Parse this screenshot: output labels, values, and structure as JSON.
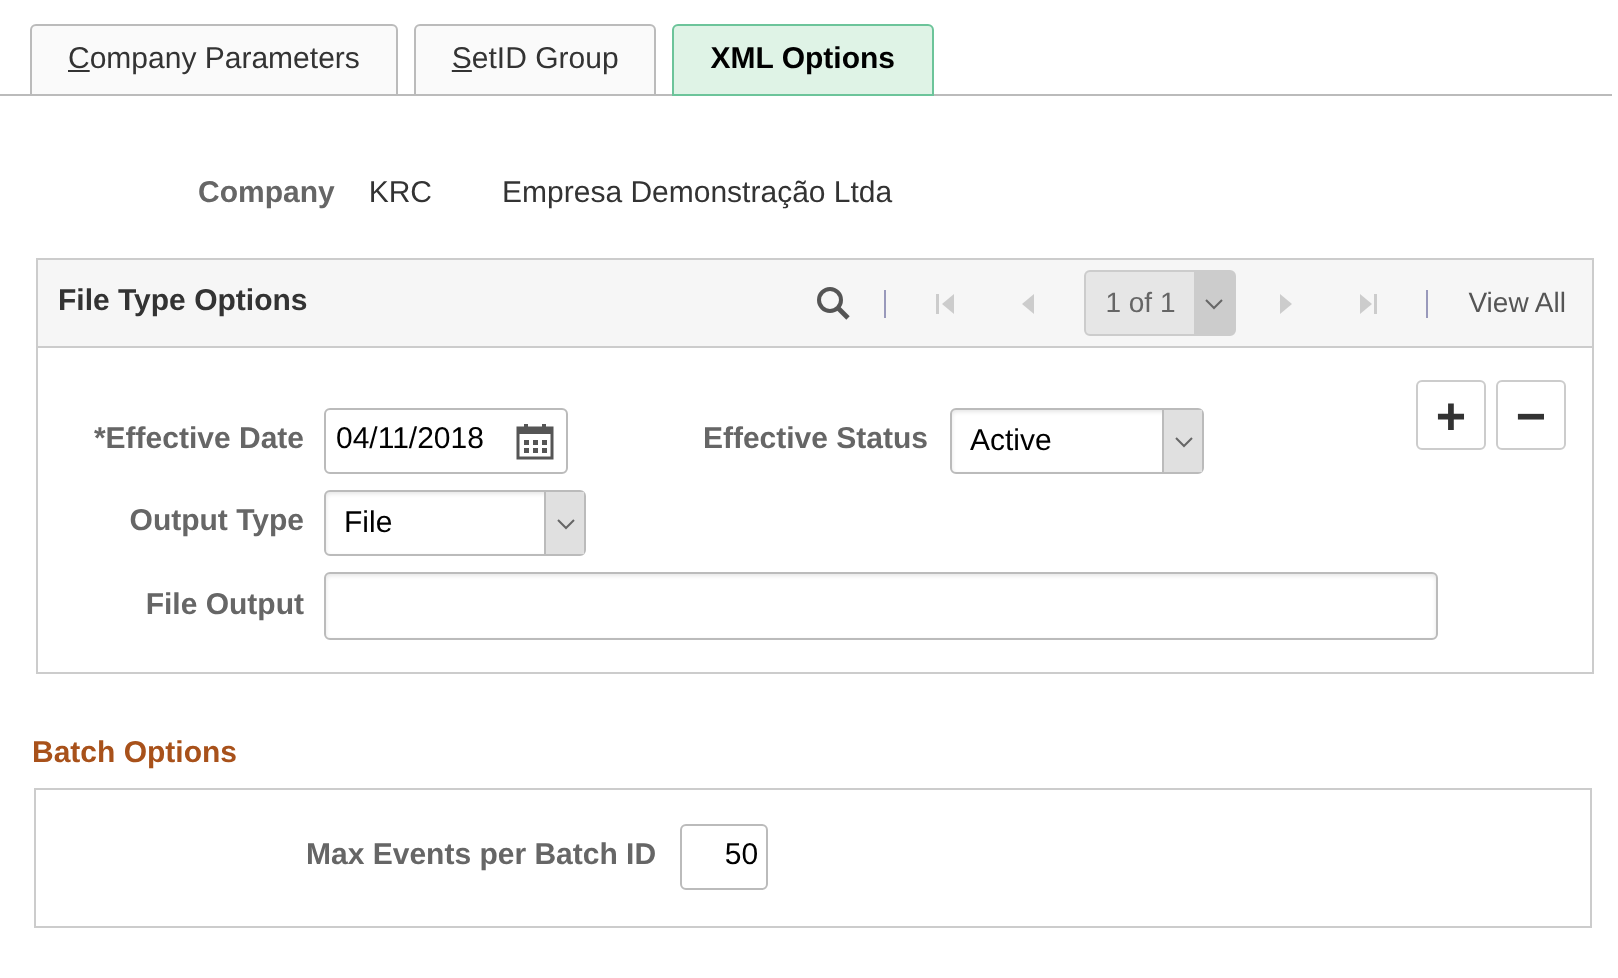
{
  "tabs": [
    {
      "label": "Company Parameters",
      "first_letter_underlined": true,
      "selected": false
    },
    {
      "label": "SetID Group",
      "first_letter_underlined": true,
      "selected": false
    },
    {
      "label": "XML Options",
      "first_letter_underlined": false,
      "selected": true
    }
  ],
  "company": {
    "label": "Company",
    "code": "KRC",
    "name": "Empresa Demonstração Ltda"
  },
  "file_type_options": {
    "title": "File Type Options",
    "pager": "1 of 1",
    "view_all": "View All",
    "add_button": "+",
    "remove_button": "−",
    "effective_date": {
      "label": "*Effective Date",
      "value": "04/11/2018"
    },
    "effective_status": {
      "label": "Effective Status",
      "value": "Active"
    },
    "output_type": {
      "label": "Output Type",
      "value": "File"
    },
    "file_output": {
      "label": "File Output"
    }
  },
  "batch_options": {
    "title": "Batch Options",
    "max_events": {
      "label": "Max Events per Batch ID",
      "value": "50"
    }
  }
}
